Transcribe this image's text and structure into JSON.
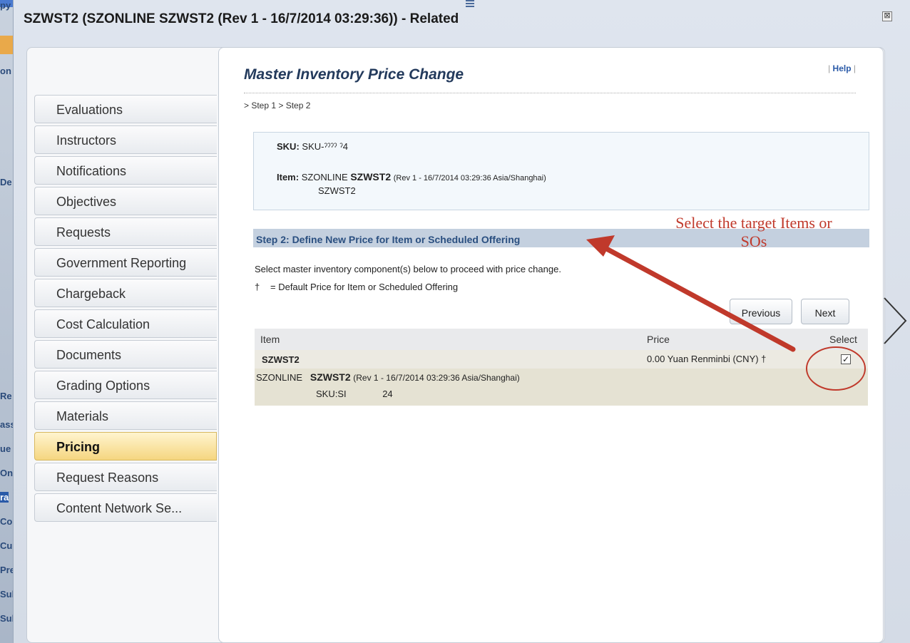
{
  "window": {
    "title": "SZWST2 (SZONLINE SZWST2 (Rev 1 - 16/7/2014 03:29:36)) - Related",
    "close_symbol": "⊠"
  },
  "background_strip": {
    "labels": [
      "py",
      "on",
      "De",
      "Re",
      "ass",
      "ue",
      "On",
      "ra",
      "Co",
      "Cu",
      "Pre",
      "Sul",
      "Sul"
    ]
  },
  "sidebar": {
    "items": [
      {
        "label": "Evaluations"
      },
      {
        "label": "Instructors"
      },
      {
        "label": "Notifications"
      },
      {
        "label": "Objectives"
      },
      {
        "label": "Requests"
      },
      {
        "label": "Government Reporting"
      },
      {
        "label": "Chargeback"
      },
      {
        "label": "Cost Calculation"
      },
      {
        "label": "Documents"
      },
      {
        "label": "Grading Options"
      },
      {
        "label": "Materials"
      },
      {
        "label": "Pricing",
        "active": true
      },
      {
        "label": "Request Reasons"
      },
      {
        "label": "Content Network Se..."
      }
    ]
  },
  "main": {
    "page_title": "Master Inventory Price Change",
    "help_prefix": "| ",
    "help_label": "Help",
    "help_suffix": " |",
    "breadcrumb": "> Step 1 > Step 2",
    "sku": {
      "sku_label": "SKU:",
      "sku_value": "SKU-ˀˀˀˀ    ˀ4",
      "item_label": "Item:",
      "item_prefix": "SZONLINE",
      "item_code": "SZWST2",
      "item_rev": "(Rev 1 - 16/7/2014 03:29:36 Asia/Shanghai)",
      "item_line2": "SZWST2"
    },
    "step_header": "Step 2: Define New Price for Item or Scheduled Offering",
    "instruction": "Select master inventory component(s) below to proceed with price change.",
    "legend_dagger": "†",
    "legend_text": "= Default Price for Item or Scheduled Offering",
    "buttons": {
      "previous": "Previous",
      "next": "Next"
    },
    "grid": {
      "columns": {
        "item": "Item",
        "price": "Price",
        "select": "Select"
      },
      "rows": [
        {
          "item": "SZWST2",
          "price": "0.00 Yuan Renminbi (CNY) †",
          "selected": true,
          "check_mark": "✓",
          "detail_prefix": "SZONLINE",
          "detail_code": "SZWST2",
          "detail_rev": "(Rev 1 - 16/7/2014 03:29:36 Asia/Shanghai)",
          "detail_sku": "SKU:SI              24"
        }
      ]
    }
  },
  "annotation": {
    "text_line1": "Select the target Items or",
    "text_line2": "SOs",
    "color": "#c0392b"
  }
}
